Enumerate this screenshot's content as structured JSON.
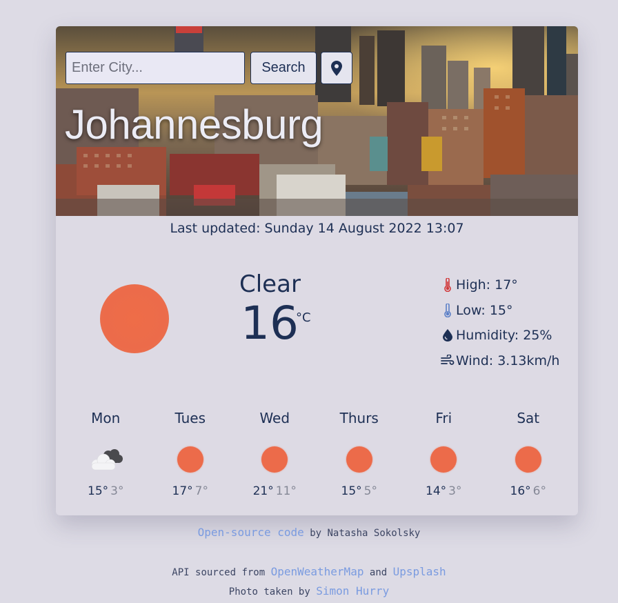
{
  "search": {
    "placeholder": "Enter City...",
    "button_label": "Search"
  },
  "location_button": {
    "icon": "map-pin-icon"
  },
  "city": "Johannesburg",
  "last_updated": "Last updated: Sunday 14 August 2022 13:07",
  "current": {
    "description": "Clear",
    "temperature": "16",
    "unit": "°C",
    "icon": "sun-icon",
    "high": "High: 17°",
    "low": "Low: 15°",
    "humidity": "Humidity: 25%",
    "wind": "Wind: 3.13km/h"
  },
  "forecast": [
    {
      "day": "Mon",
      "icon": "cloud-icon",
      "high": "15°",
      "low": "3°"
    },
    {
      "day": "Tues",
      "icon": "sun-icon",
      "high": "17°",
      "low": "7°"
    },
    {
      "day": "Wed",
      "icon": "sun-icon",
      "high": "21°",
      "low": "11°"
    },
    {
      "day": "Thurs",
      "icon": "sun-icon",
      "high": "15°",
      "low": "5°"
    },
    {
      "day": "Fri",
      "icon": "sun-icon",
      "high": "14°",
      "low": "3°"
    },
    {
      "day": "Sat",
      "icon": "sun-icon",
      "high": "16°",
      "low": "6°"
    }
  ],
  "footer": {
    "source_link": "Open-source code",
    "by_text": "by Natasha Sokolsky",
    "api_text": "API sourced from",
    "api_link_1": "OpenWeatherMap",
    "and_text": "and",
    "api_link_2": "Upsplash",
    "photo_text": "Photo taken by",
    "photo_link": "Simon Hurry"
  },
  "colors": {
    "page_bg": "#dddbe5",
    "card_bg": "#dddae4",
    "text": "#1d2f54",
    "accent_sun": "#ec6b4a",
    "link": "#7a9be0",
    "thermometer_high": "#d1393b",
    "thermometer_low": "#5b7fc7"
  }
}
